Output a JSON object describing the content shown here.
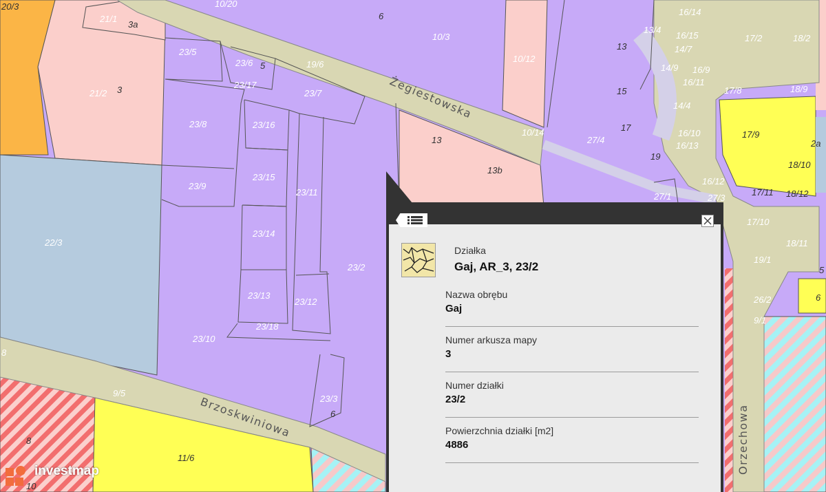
{
  "map": {
    "parcels": [
      "20/3",
      "21/1",
      "3a",
      "21/2",
      "3",
      "10/20",
      "6",
      "10/3",
      "10/12",
      "23/5",
      "23/6",
      "5",
      "19/6",
      "23/17",
      "23/7",
      "23/8",
      "23/16",
      "13",
      "13b",
      "10/14",
      "27/4",
      "13/4",
      "16/14",
      "16/15",
      "14/7",
      "14/9",
      "16/9",
      "16/11",
      "17/2",
      "18/2",
      "17/8",
      "18/9",
      "14/4",
      "16/10",
      "16/13",
      "17/9",
      "2a",
      "18/10",
      "15",
      "17",
      "19",
      "16/12",
      "17/11",
      "18/12",
      "27/3",
      "27/1",
      "23/9",
      "23/15",
      "23/11",
      "22/3",
      "23/14",
      "23/2",
      "17/10",
      "18/11",
      "19/1",
      "5",
      "23/13",
      "23/12",
      "23/18",
      "26/2",
      "6",
      "23/10",
      "9/1",
      "9/5",
      "23/3",
      "6",
      "8",
      "11/6",
      "10",
      "8"
    ],
    "streets": [
      "Żegiestowska",
      "Brzoskwiniowa",
      "Orzechowa"
    ]
  },
  "popup": {
    "layer_label": "Działka",
    "title": "Gaj, AR_3, 23/2",
    "fields": [
      {
        "name": "Nazwa obrębu",
        "value": "Gaj"
      },
      {
        "name": "Numer arkusza mapy",
        "value": "3"
      },
      {
        "name": "Numer działki",
        "value": "23/2"
      },
      {
        "name": "Powierzchnia działki [m2]",
        "value": "4886"
      }
    ],
    "list_icon": "list-icon",
    "close_icon": "close-icon"
  },
  "watermark": {
    "text": "investmap",
    "logo_icon": "investmap-logo-icon"
  },
  "colors": {
    "residential": "#c7aaf8",
    "services": "#fbcfcb",
    "green": "#b5cbde",
    "yellow": "#ffff55",
    "orange": "#fbb546",
    "road": "#d9d7b3",
    "hatch_red": "#f26e6e",
    "hatch_cyan": "#a6f2f5"
  }
}
